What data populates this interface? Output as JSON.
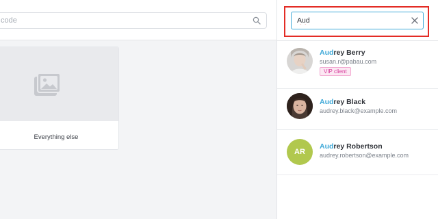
{
  "left": {
    "search": {
      "placeholder": "code"
    },
    "card": {
      "label": "Everything else",
      "image_icon": "image-placeholder-icon"
    }
  },
  "client_search": {
    "value": "Aud",
    "clear_icon": "close-icon",
    "highlight_color": "#e32c25",
    "focus_color": "#3fa9d8"
  },
  "results": [
    {
      "name_match": "Aud",
      "name_rest": "rey Berry",
      "email": "susan.r@pabau.com",
      "badge": "VIP client",
      "avatar": "photo"
    },
    {
      "name_match": "Aud",
      "name_rest": "rey Black",
      "email": "audrey.black@example.com",
      "avatar": "photo"
    },
    {
      "name_match": "Aud",
      "name_rest": "rey Robertson",
      "email": "audrey.robertson@example.com",
      "avatar": "initials",
      "initials": "AR",
      "avatar_color": "#b1c84e"
    }
  ]
}
